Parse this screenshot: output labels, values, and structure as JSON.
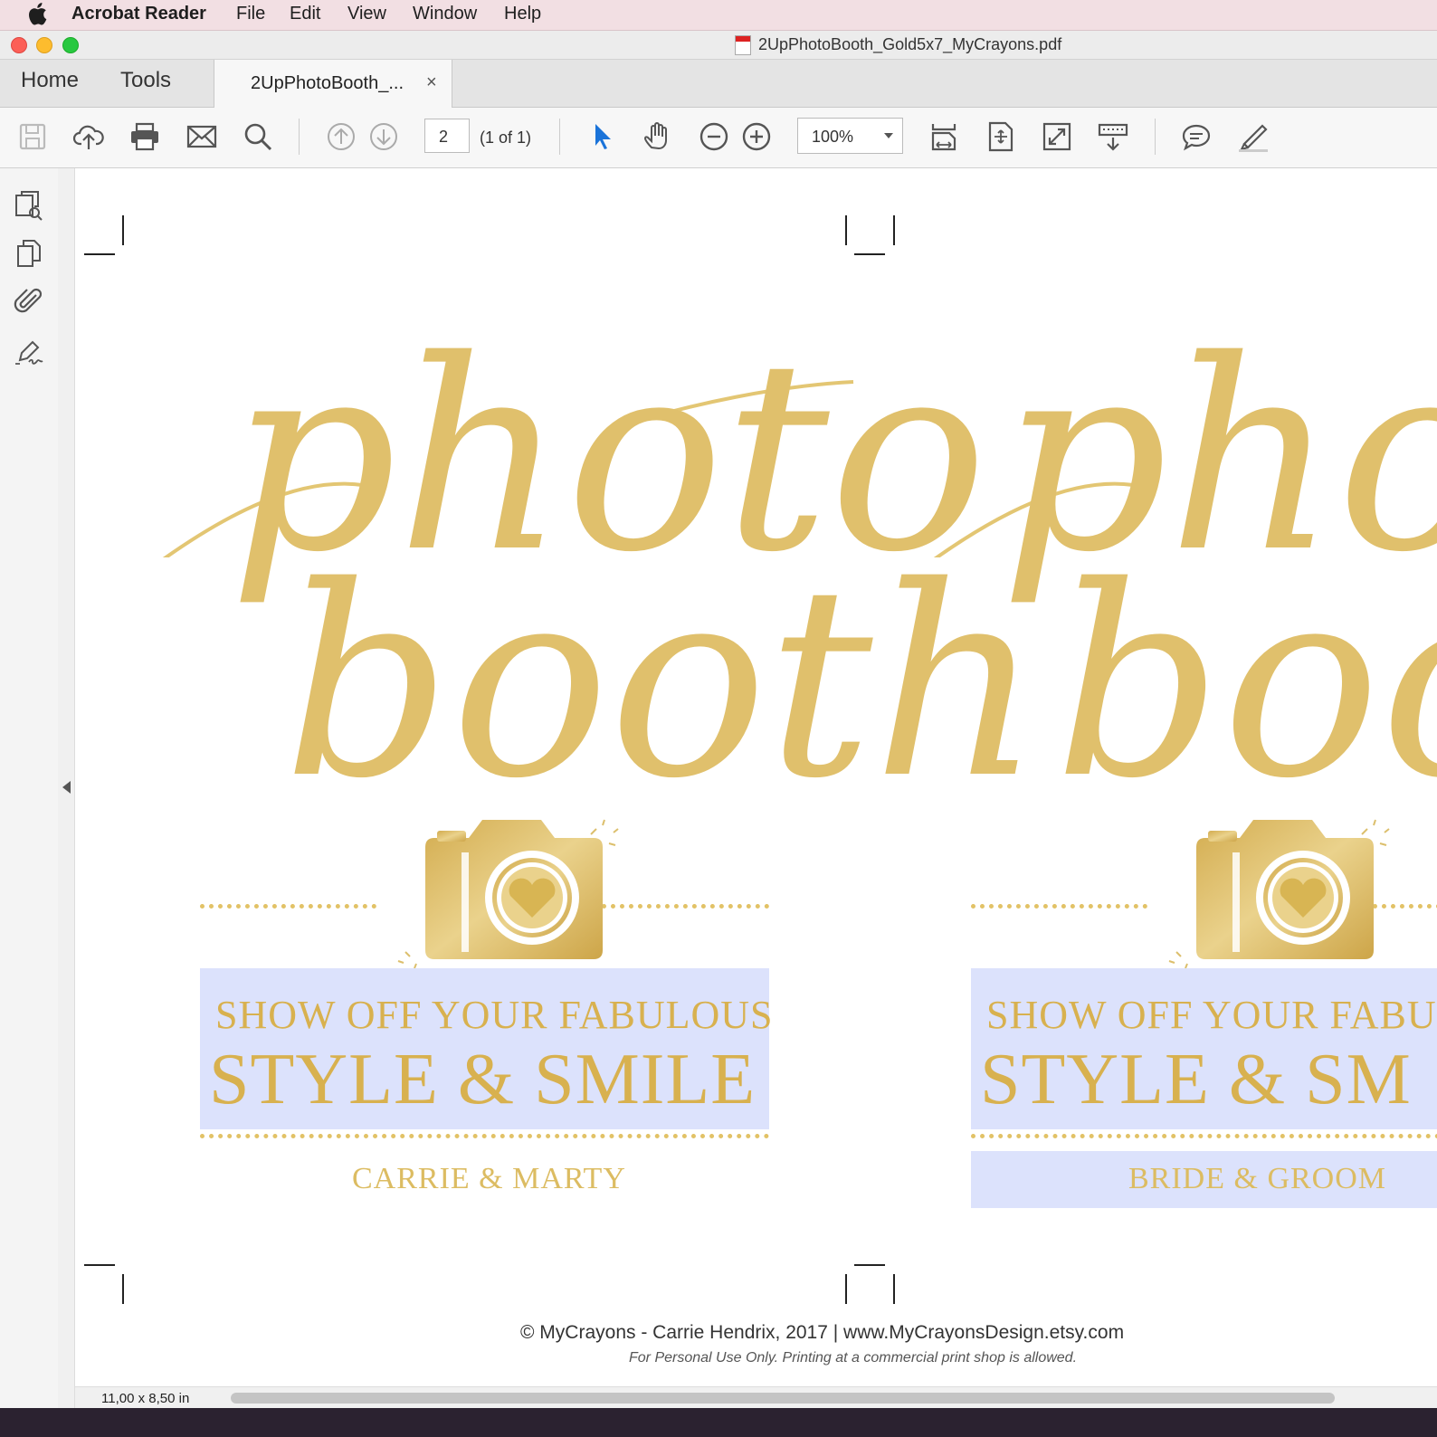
{
  "menubar": {
    "app": "Acrobat Reader",
    "items": [
      "File",
      "Edit",
      "View",
      "Window",
      "Help"
    ]
  },
  "window": {
    "title": "2UpPhotoBooth_Gold5x7_MyCrayons.pdf"
  },
  "tabs": {
    "home": "Home",
    "tools": "Tools",
    "document": "2UpPhotoBooth_...",
    "close": "×"
  },
  "toolbar": {
    "page_number": "2",
    "page_of": "(1 of 1)",
    "zoom": "100%"
  },
  "icons": [
    "save-icon",
    "cloud-upload-icon",
    "print-icon",
    "email-icon",
    "search-icon",
    "page-up-icon",
    "page-down-icon",
    "select-arrow-icon",
    "hand-icon",
    "zoom-out-icon",
    "zoom-in-icon",
    "scroll-mode-icon",
    "fit-page-icon",
    "full-screen-icon",
    "read-mode-icon",
    "comment-icon",
    "highlight-pen-icon",
    "page-thumbnails-icon",
    "copy-pages-icon",
    "attachment-icon",
    "signature-icon"
  ],
  "accent_gold": "#e0c06c",
  "highlight_color": "#dce2fc",
  "document": {
    "cards": [
      {
        "script_line1": "photo",
        "script_line2": "booth",
        "tagline_small": "SHOW OFF YOUR FABULOUS",
        "tagline_big": "STYLE & SMILE",
        "names": "CARRIE & MARTY"
      },
      {
        "script_line1": "photo",
        "script_line2": "booth",
        "tagline_small": "SHOW OFF YOUR FABU",
        "tagline_big": "STYLE & SM",
        "names": "BRIDE & GROOM"
      }
    ],
    "copyright": "© MyCrayons - Carrie Hendrix, 2017  |  www.MyCrayonsDesign.etsy.com",
    "personal_use": "For Personal Use Only. Printing at a commercial print shop is allowed."
  },
  "status": {
    "page_size": "11,00 x 8,50 in"
  }
}
